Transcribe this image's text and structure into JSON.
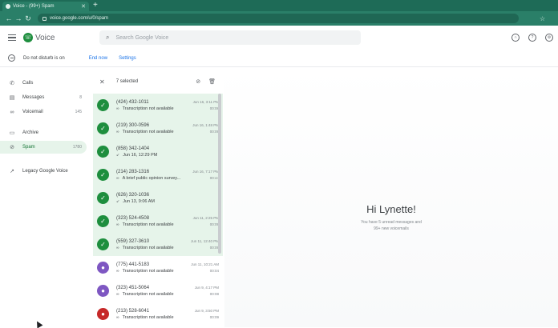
{
  "browser": {
    "tab_title": "Voice - (99+) Spam",
    "new_tab": "+",
    "url": "voice.google.com/u/0/spam"
  },
  "header": {
    "app_name": "Voice",
    "search_placeholder": "Search Google Voice"
  },
  "dnd": {
    "status": "Do not disturb is on",
    "end_now": "End now",
    "settings": "Settings"
  },
  "sidebar": {
    "items": [
      {
        "label": "Calls",
        "icon": "phone-icon",
        "count": ""
      },
      {
        "label": "Messages",
        "icon": "message-icon",
        "count": "8"
      },
      {
        "label": "Voicemail",
        "icon": "voicemail-icon",
        "count": "145"
      },
      {
        "label": "Archive",
        "icon": "archive-icon",
        "count": ""
      },
      {
        "label": "Spam",
        "icon": "spam-icon",
        "count": "1780"
      },
      {
        "label": "Legacy Google Voice",
        "icon": "external-link-icon",
        "count": ""
      }
    ]
  },
  "selection": {
    "count_label": "7 selected"
  },
  "list": [
    {
      "number": "(424) 432-1011",
      "time": "Jun 16, 3:11 PM",
      "preview": "Transcription not available",
      "duration": "00:08",
      "selected": true
    },
    {
      "number": "(219) 300-0596",
      "time": "Jun 16, 1:48 PM",
      "preview": "Transcription not available",
      "duration": "00:09",
      "selected": true
    },
    {
      "number": "(858) 342-1404",
      "time": "",
      "preview": "Jun 16, 12:29 PM",
      "duration": "",
      "selected": true
    },
    {
      "number": "(214) 283-1316",
      "time": "Jun 16, 7:17 PM",
      "preview": "A brief public opinion survey...",
      "duration": "00:44",
      "selected": true
    },
    {
      "number": "(626) 320-1036",
      "time": "",
      "preview": "Jun 13, 9:06 AM",
      "duration": "",
      "selected": true
    },
    {
      "number": "(323) 524-4508",
      "time": "Jun 11, 2:25 PM",
      "preview": "Transcription not available",
      "duration": "00:09",
      "selected": true
    },
    {
      "number": "(559) 327-3610",
      "time": "Jun 11, 12:40 PM",
      "preview": "Transcription not available",
      "duration": "00:09",
      "selected": true
    },
    {
      "number": "(775) 441-5183",
      "time": "Jun 11, 10:21 AM",
      "preview": "Transcription not available",
      "duration": "00:04",
      "selected": false,
      "avatar_color": "#7e57c2"
    },
    {
      "number": "(323) 451-5064",
      "time": "Jun 9, 4:17 PM",
      "preview": "Transcription not available",
      "duration": "00:08",
      "selected": false,
      "avatar_color": "#7e57c2"
    },
    {
      "number": "(213) 528-6041",
      "time": "Jun 9, 3:50 PM",
      "preview": "Transcription not available",
      "duration": "00:09",
      "selected": false,
      "avatar_color": "#c62828"
    }
  ],
  "main": {
    "greeting": "Hi Lynette!",
    "subtitle_line1": "You have 5 unread messages and",
    "subtitle_line2": "99+ new voicemails"
  }
}
